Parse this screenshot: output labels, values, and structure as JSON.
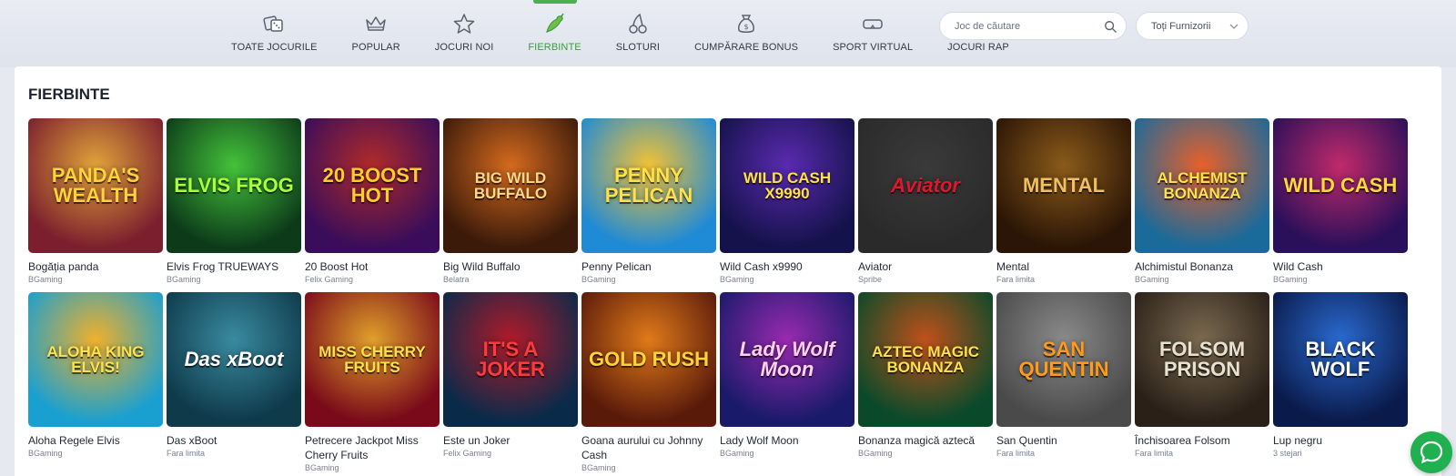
{
  "nav": {
    "items": [
      {
        "label": "TOATE JOCURILE",
        "icon": "dice-icon",
        "active": false
      },
      {
        "label": "POPULAR",
        "icon": "crown-icon",
        "active": false
      },
      {
        "label": "JOCURI NOI",
        "icon": "star-icon",
        "active": false
      },
      {
        "label": "FIERBINTE",
        "icon": "chili-icon",
        "active": true
      },
      {
        "label": "SLOTURI",
        "icon": "cherries-icon",
        "active": false
      },
      {
        "label": "CUMPĂRARE BONUS",
        "icon": "money-bag-icon",
        "active": false
      },
      {
        "label": "SPORT VIRTUAL",
        "icon": "vr-goggles-icon",
        "active": false
      },
      {
        "label": "JOCURI RAP",
        "icon": "lightning-icon",
        "active": false
      }
    ]
  },
  "search": {
    "placeholder": "Joc de căutare",
    "value": ""
  },
  "provider_filter": {
    "selected": "Toți Furnizorii"
  },
  "section": {
    "title": "FIERBINTE"
  },
  "colors": {
    "accent": "#4caf50",
    "chat": "#21b04f"
  },
  "games": [
    {
      "name": "Bogăția panda",
      "provider": "BGaming",
      "art_title": "PANDA'S WEALTH",
      "bg": "#7b1f2e",
      "bg2": "#e0a33a",
      "fg": "#ffd23a"
    },
    {
      "name": "Elvis Frog TRUEWAYS",
      "provider": "BGaming",
      "art_title": "ELVIS FROG",
      "bg": "#0d3b1a",
      "bg2": "#43c23a",
      "fg": "#a8ff3a"
    },
    {
      "name": "20 Boost Hot",
      "provider": "Felix Gaming",
      "art_title": "20 BOOST HOT",
      "bg": "#3a0d5a",
      "bg2": "#b02a2a",
      "fg": "#ffcc2a"
    },
    {
      "name": "Big Wild Buffalo",
      "provider": "Belatra",
      "art_title": "BIG WILD BUFFALO",
      "bg": "#3b1a0a",
      "bg2": "#d46a1e",
      "fg": "#ffd88a"
    },
    {
      "name": "Penny Pelican",
      "provider": "BGaming",
      "art_title": "PENNY PELICAN",
      "bg": "#1f8ad6",
      "bg2": "#f3c234",
      "fg": "#ffe14a"
    },
    {
      "name": "Wild Cash x9990",
      "provider": "BGaming",
      "art_title": "WILD CASH X9990",
      "bg": "#14124a",
      "bg2": "#5a2ab0",
      "fg": "#ffe04a"
    },
    {
      "name": "Aviator",
      "provider": "Spribe",
      "art_title": "Aviator",
      "bg": "#2a2a2a",
      "bg2": "#3a3a3a",
      "fg": "#e0152e"
    },
    {
      "name": "Mental",
      "provider": "Fara limita",
      "art_title": "MENTAL",
      "bg": "#2a1506",
      "bg2": "#8a5a1a",
      "fg": "#f0c060"
    },
    {
      "name": "Alchimistul Bonanza",
      "provider": "BGaming",
      "art_title": "ALCHEMIST BONANZA",
      "bg": "#1a6a9a",
      "bg2": "#e8602a",
      "fg": "#ffe24a"
    },
    {
      "name": "Wild Cash",
      "provider": "BGaming",
      "art_title": "WILD CASH",
      "bg": "#2a0f5a",
      "bg2": "#c02a6a",
      "fg": "#ffd83a"
    },
    {
      "name": "Aloha Regele Elvis",
      "provider": "BGaming",
      "art_title": "ALOHA KING ELVIS!",
      "bg": "#1aa0d0",
      "bg2": "#f0b02a",
      "fg": "#ffe24a"
    },
    {
      "name": "Das xBoot",
      "provider": "Fara limita",
      "art_title": "Das xBoot",
      "bg": "#0e3a4a",
      "bg2": "#3a8aa0",
      "fg": "#ffffff"
    },
    {
      "name": "Petrecere Jackpot Miss Cherry Fruits",
      "provider": "BGaming",
      "art_title": "MISS CHERRY FRUITS",
      "bg": "#7a0a1a",
      "bg2": "#e0a02a",
      "fg": "#ffe04a"
    },
    {
      "name": "Este un Joker",
      "provider": "Felix Gaming",
      "art_title": "IT'S A JOKER",
      "bg": "#0a2a4a",
      "bg2": "#b01a2a",
      "fg": "#ff3a3a"
    },
    {
      "name": "Goana aurului cu Johnny Cash",
      "provider": "BGaming",
      "art_title": "GOLD RUSH",
      "bg": "#5a1a0a",
      "bg2": "#e07a1a",
      "fg": "#ffd23a"
    },
    {
      "name": "Lady Wolf Moon",
      "provider": "BGaming",
      "art_title": "Lady Wolf Moon",
      "bg": "#1a1a6a",
      "bg2": "#9a2ab0",
      "fg": "#ffd0f0"
    },
    {
      "name": "Bonanza magică aztecă",
      "provider": "BGaming",
      "art_title": "AZTEC MAGIC BONANZA",
      "bg": "#0a4a2a",
      "bg2": "#c0501a",
      "fg": "#ffe04a"
    },
    {
      "name": "San Quentin",
      "provider": "Fara limita",
      "art_title": "SAN QUENTIN",
      "bg": "#4a4a4a",
      "bg2": "#8a8a8a",
      "fg": "#ff9a1a"
    },
    {
      "name": "Închisoarea Folsom",
      "provider": "Fara limita",
      "art_title": "FOLSOM PRISON",
      "bg": "#2a2018",
      "bg2": "#7a6a50",
      "fg": "#e8e0d0"
    },
    {
      "name": "Lup negru",
      "provider": "3 stejari",
      "art_title": "BLACK WOLF",
      "bg": "#0a1a4a",
      "bg2": "#2a6ad0",
      "fg": "#ffffff"
    }
  ]
}
